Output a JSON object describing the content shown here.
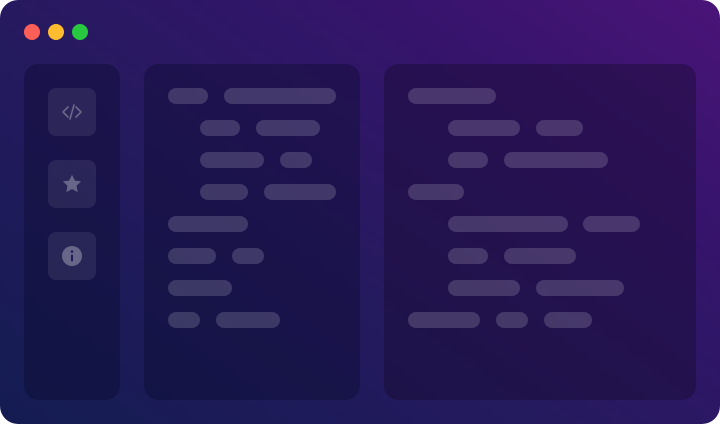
{
  "window": {
    "controls": [
      {
        "name": "close",
        "color": "#ff5f57"
      },
      {
        "name": "minimize",
        "color": "#febc2e"
      },
      {
        "name": "zoom",
        "color": "#28c840"
      }
    ]
  },
  "sidebar": {
    "items": [
      {
        "icon": "code-icon"
      },
      {
        "icon": "star-icon"
      },
      {
        "icon": "info-icon"
      }
    ]
  },
  "colors": {
    "background_start": "#141c52",
    "background_end": "#4a1478",
    "placeholder": "rgba(255,255,255,0.16)",
    "icon": "rgba(255,255,255,0.30)"
  }
}
